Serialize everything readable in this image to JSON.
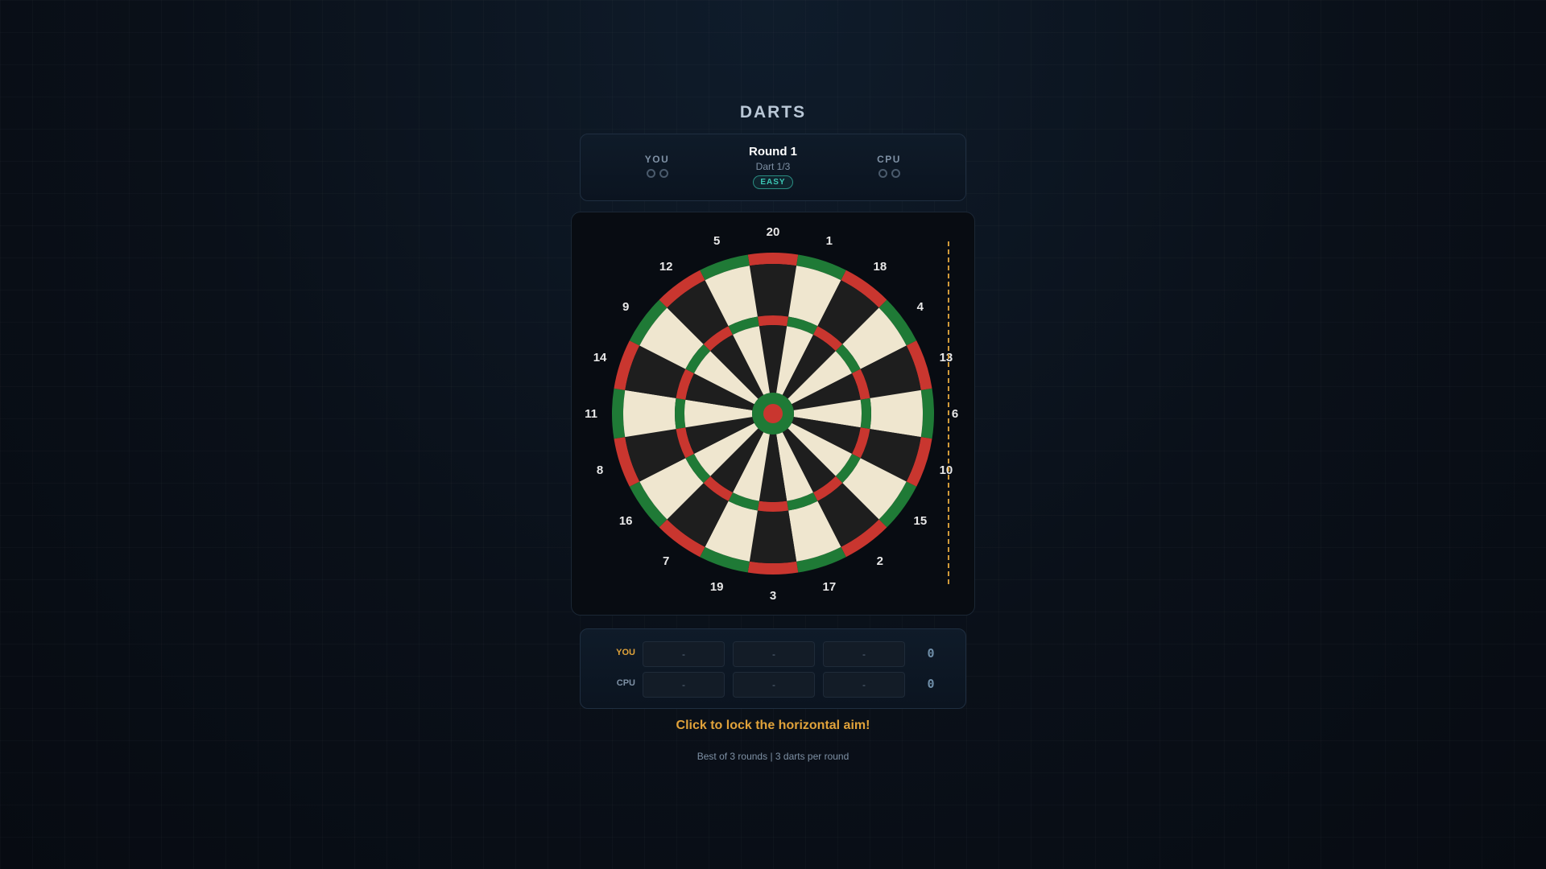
{
  "game": {
    "title": "DARTS",
    "instruction": "Click to lock the horizontal aim!",
    "footer": "Best of 3 rounds | 3 darts per round"
  },
  "status": {
    "you_label": "YOU",
    "cpu_label": "CPU",
    "round_label": "Round 1",
    "dart_label": "Dart 1/3",
    "difficulty": "EASY",
    "rounds_won": {
      "you": 0,
      "cpu": 0
    },
    "pips_per_player": 2
  },
  "board": {
    "numbers": [
      "20",
      "1",
      "18",
      "4",
      "13",
      "6",
      "10",
      "15",
      "2",
      "17",
      "3",
      "19",
      "7",
      "16",
      "8",
      "11",
      "14",
      "9",
      "12",
      "5"
    ],
    "colors": {
      "cream": "#efe6cf",
      "black": "#1e1e1e",
      "red": "#c9362f",
      "green": "#1f7a36",
      "aim_line": "#d09a3a",
      "number_text": "#e8e8e8"
    }
  },
  "scoreboard": {
    "rows": [
      {
        "label": "YOU",
        "darts": [
          "-",
          "-",
          "-"
        ],
        "total": "0"
      },
      {
        "label": "CPU",
        "darts": [
          "-",
          "-",
          "-"
        ],
        "total": "0"
      }
    ]
  }
}
